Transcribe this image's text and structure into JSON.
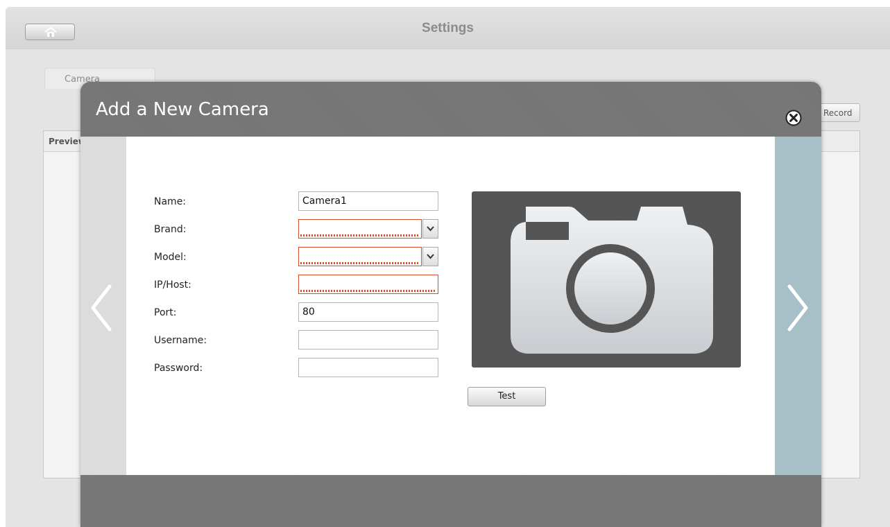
{
  "window": {
    "title": "Settings"
  },
  "background": {
    "tab_label": "Camera",
    "record_button": "Record",
    "panel_header": "Preview"
  },
  "modal": {
    "title": "Add a New Camera",
    "form": {
      "name_label": "Name:",
      "name_value": "Camera1",
      "brand_label": "Brand:",
      "brand_value": "",
      "model_label": "Model:",
      "model_value": "",
      "ip_label": "IP/Host:",
      "ip_value": "",
      "port_label": "Port:",
      "port_value": "80",
      "username_label": "Username:",
      "username_value": "",
      "password_label": "Password:",
      "password_value": ""
    },
    "test_button": "Test"
  },
  "icons": [
    "home-icon",
    "close-icon",
    "chevron-left-icon",
    "chevron-right-icon",
    "camera-icon",
    "dropdown-arrow-icon"
  ],
  "colors": {
    "error_border": "#d94a2e",
    "nav_right": "#a7c0c8",
    "header_gray": "#777777"
  }
}
